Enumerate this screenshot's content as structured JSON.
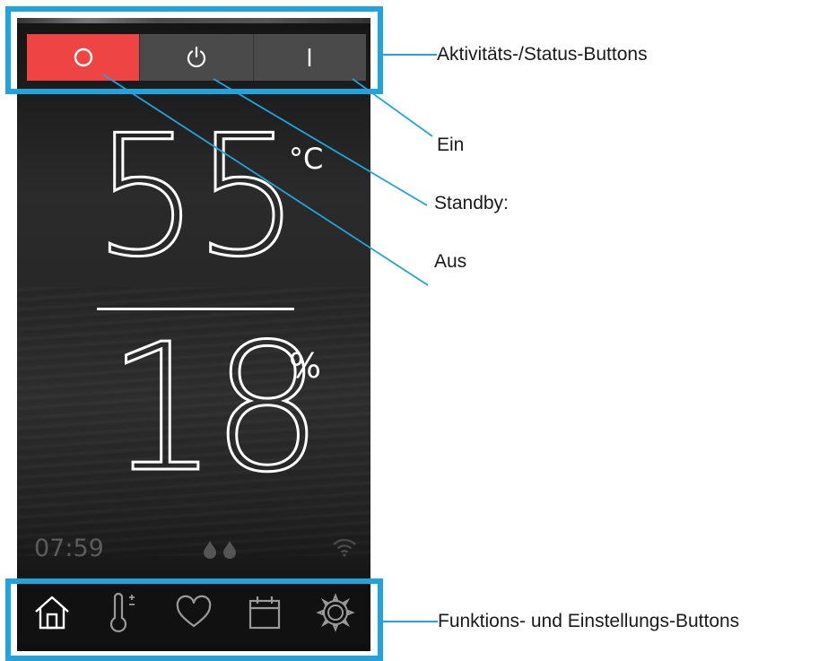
{
  "status_buttons": [
    {
      "name": "Aus",
      "glyph": "O",
      "active": true
    },
    {
      "name": "Standby",
      "glyph": "⏻",
      "active": false
    },
    {
      "name": "Ein",
      "glyph": "|",
      "active": false
    }
  ],
  "readout": {
    "temperature": "55",
    "temperature_unit": "°C",
    "humidity": "18",
    "humidity_unit": "%"
  },
  "status_bar": {
    "clock": "07:59",
    "icons": [
      "water-drops-icon",
      "wifi-icon"
    ]
  },
  "nav": {
    "icons": [
      "home-icon",
      "thermometer-plus-minus-icon",
      "heart-icon",
      "calendar-icon",
      "gear-icon"
    ],
    "active": "home-icon"
  },
  "annotations": {
    "status_group": "Aktivitäts-/Status-Buttons",
    "ein": "Ein",
    "standby": "Standby:",
    "aus": "Aus",
    "function_group": "Funktions- und Einstellungs-Buttons"
  },
  "colors": {
    "accent_red": "#ef4444",
    "annotation_blue": "#1fa4e0",
    "screen_dark": "#232323"
  }
}
